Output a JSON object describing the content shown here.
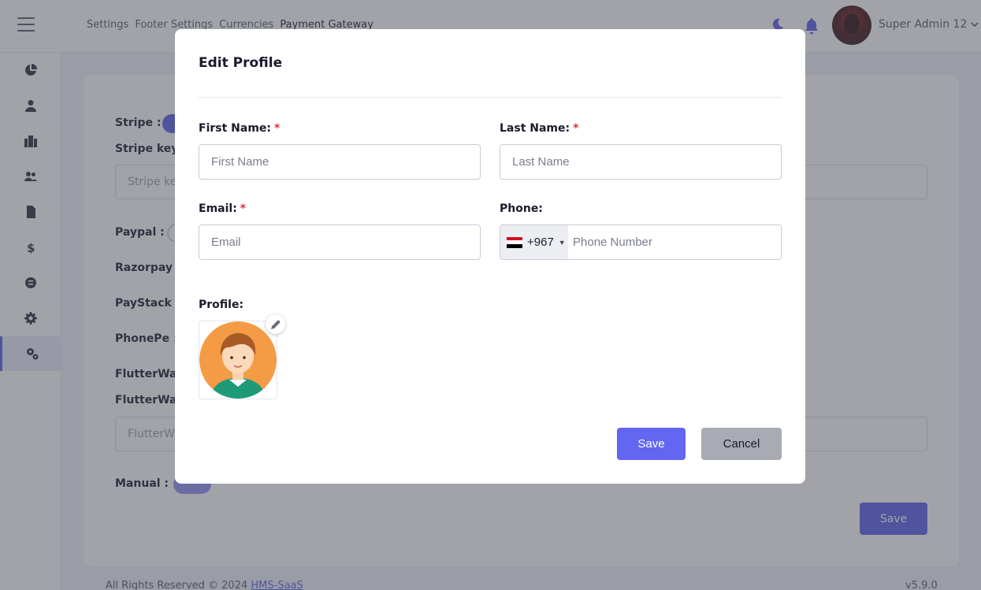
{
  "header": {
    "breadcrumbs": [
      "Settings",
      "Footer Settings",
      "Currencies",
      "Payment Gateway"
    ],
    "user_name": "Super Admin 12",
    "icons": [
      "menu-icon",
      "moon-icon",
      "bell-icon",
      "avatar",
      "chevron-down-icon"
    ]
  },
  "sidebar": {
    "items": [
      {
        "icon": "pie-chart-icon"
      },
      {
        "icon": "user-icon"
      },
      {
        "icon": "hospital-icon"
      },
      {
        "icon": "users-icon"
      },
      {
        "icon": "document-icon"
      },
      {
        "icon": "dollar-icon"
      },
      {
        "icon": "subscription-icon"
      },
      {
        "icon": "gear-icon"
      },
      {
        "icon": "gears-icon",
        "active": true
      }
    ]
  },
  "background_page": {
    "stripe_label": "Stripe :",
    "stripe_key_label": "Stripe key:",
    "stripe_key_placeholder": "Stripe key",
    "paypal_label": "Paypal :",
    "razorpay_label": "Razorpay :",
    "paystack_label": "PayStack :",
    "phonepe_label": "PhonePe :",
    "flutterwave_label": "FlutterWave :",
    "flutterwave_key_label": "FlutterWave key:",
    "flutterwave_key_placeholder": "FlutterWave key",
    "manual_label": "Manual :",
    "save_label": "Save"
  },
  "footer": {
    "copyright": "All Rights Reserved © 2024",
    "brand_link": "HMS-SaaS",
    "version": "v5.9.0"
  },
  "modal": {
    "title": "Edit Profile",
    "first_name": {
      "label": "First Name:",
      "placeholder": "First Name",
      "value": "",
      "required": true
    },
    "last_name": {
      "label": "Last Name:",
      "placeholder": "Last Name",
      "value": "",
      "required": true
    },
    "email": {
      "label": "Email:",
      "placeholder": "Email",
      "value": "",
      "required": true
    },
    "phone": {
      "label": "Phone:",
      "country_code": "+967",
      "placeholder": "Phone Number",
      "value": ""
    },
    "profile": {
      "label": "Profile:"
    },
    "required_mark": "*",
    "save_label": "Save",
    "cancel_label": "Cancel"
  },
  "colors": {
    "accent": "#6366f1",
    "cancel": "#a9abb4",
    "required": "#e0303a"
  }
}
